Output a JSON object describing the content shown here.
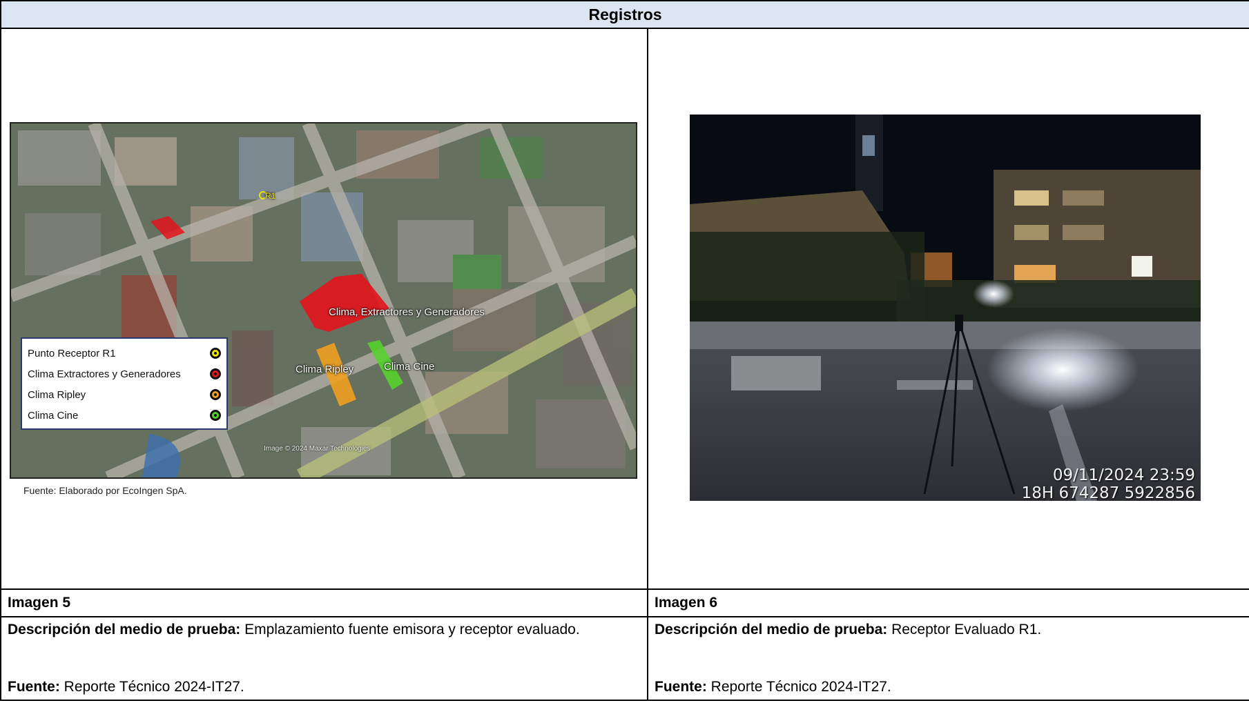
{
  "header": {
    "title": "Registros"
  },
  "left": {
    "caption": "Imagen 5",
    "desc_label": "Descripción del medio de prueba:",
    "desc_text": " Emplazamiento  fuente emisora y receptor evaluado.",
    "fuente_label": "Fuente:",
    "fuente_text": " Reporte Técnico 2024-IT27.",
    "map": {
      "legend": [
        {
          "label": "Punto Receptor R1",
          "color": "#f2e600"
        },
        {
          "label": "Clima Extractores y Generadores",
          "color": "#e3141c"
        },
        {
          "label": "Clima Ripley",
          "color": "#f0a020"
        },
        {
          "label": "Clima Cine",
          "color": "#55d12e"
        }
      ],
      "labels": {
        "r1": "R1",
        "clima_ext": "Clima, Extractores y Generadores",
        "clima_ripley": "Clima Ripley",
        "clima_cine": "Clima Cine"
      },
      "image_credit": "Image © 2024 Maxar Technologies",
      "source_note": "Fuente: Elaborado por EcoIngen SpA."
    }
  },
  "right": {
    "caption": "Imagen 6",
    "desc_label": "Descripción del medio de prueba:",
    "desc_text": " Receptor Evaluado R1.",
    "fuente_label": "Fuente:",
    "fuente_text": " Reporte Técnico 2024-IT27.",
    "photo": {
      "timestamp": "09/11/2024 23:59",
      "coords": "18H 674287 5922856"
    }
  }
}
